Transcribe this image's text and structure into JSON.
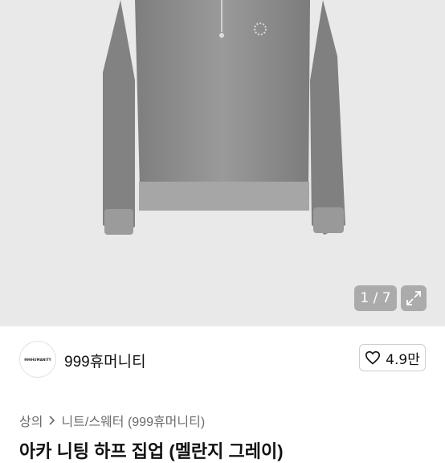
{
  "gallery": {
    "counter": "1 / 7",
    "expand_icon": "expand-icon"
  },
  "seller": {
    "avatar_text": "999HUMANITY",
    "name": "999휴머니티",
    "likes": "4.9만",
    "like_icon": "heart-icon"
  },
  "breadcrumb": {
    "category": "상의",
    "subcategory": "니트/스웨터 (999휴머니티)",
    "separator_icon": "chevron-right-icon"
  },
  "product": {
    "title": "아카 니팅 하프 집업 (멜란지 그레이)"
  }
}
